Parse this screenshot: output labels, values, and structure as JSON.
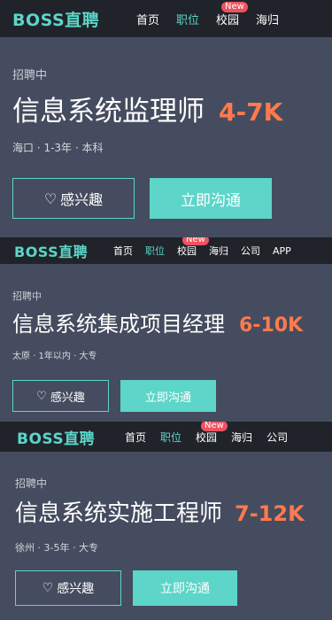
{
  "nav": {
    "logo": "BOSS直聘",
    "items": [
      "首页",
      "职位",
      "校园",
      "海归",
      "公司",
      "APP"
    ],
    "new_badge": "New",
    "active_item": "职位"
  },
  "cards": [
    {
      "status": "招聘中",
      "title": "信息系统监理师",
      "salary": "4-7K",
      "meta": "海口 · 1-3年 · 本科",
      "interest_label": "感兴趣",
      "chat_label": "立即沟通"
    },
    {
      "status": "招聘中",
      "title": "信息系统集成项目经理",
      "salary": "6-10K",
      "meta": "太原 · 1年以内 · 大专",
      "interest_label": "感兴趣",
      "chat_label": "立即沟通"
    },
    {
      "status": "招聘中",
      "title": "信息系统实施工程师",
      "salary": "7-12K",
      "meta": "徐州 · 3-5年 · 大专",
      "interest_label": "感兴趣",
      "chat_label": "立即沟通"
    }
  ],
  "colors": {
    "accent": "#5dd5c8",
    "salary": "#ff7a4d",
    "nav_bg": "#20242a",
    "card_bg": "#454c5f",
    "badge": "#ef5261"
  }
}
